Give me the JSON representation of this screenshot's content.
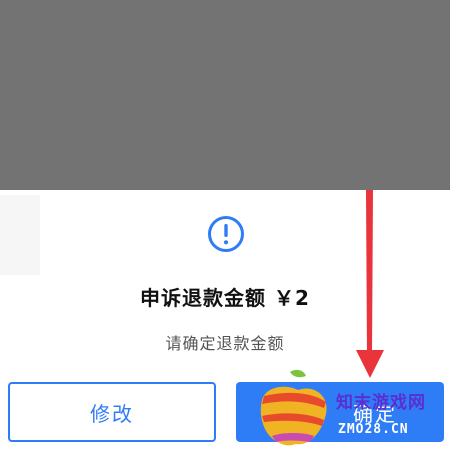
{
  "dialog": {
    "title": "申诉退款金额 ￥2",
    "subtitle": "请确定退款金额",
    "icon": "info-circle-icon",
    "accent_color": "#2f7df6"
  },
  "buttons": {
    "modify_label": "修改",
    "confirm_label": "确定"
  },
  "overlay_color": "#737373",
  "annotation": {
    "icon": "red-arrow-down-icon",
    "color": "#e8343a"
  },
  "watermark": {
    "logo": "fruit-logo-icon",
    "text_cn": "知末游戏网",
    "text_en": "ZMO28.CN"
  }
}
